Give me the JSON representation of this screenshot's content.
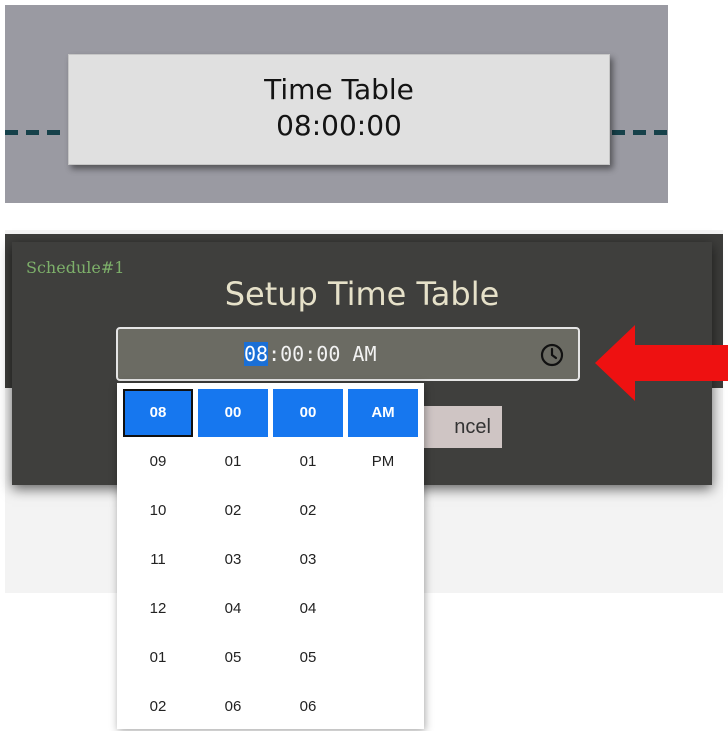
{
  "time_table_node": {
    "title": "Time Table",
    "time": "08:00:00"
  },
  "dialog": {
    "schedule_label": "Schedule#1",
    "title": "Setup Time Table",
    "time_input": {
      "hour": "08",
      "minute": "00",
      "second": "00",
      "ampm": "AM",
      "sep": ":"
    },
    "cancel_label": "ncel"
  },
  "icons": {
    "clock": "clock-icon",
    "arrow": "red-arrow-left-icon"
  },
  "picker": {
    "hours": [
      "08",
      "09",
      "10",
      "11",
      "12",
      "01",
      "02"
    ],
    "minutes": [
      "00",
      "01",
      "02",
      "03",
      "04",
      "05",
      "06"
    ],
    "seconds": [
      "00",
      "01",
      "02",
      "03",
      "04",
      "05",
      "06"
    ],
    "periods": [
      "AM",
      "PM"
    ]
  },
  "colors": {
    "selected": "#1677ef",
    "highlight": "#1a6fd6",
    "arrow": "#ee1111",
    "schedule_label": "#7db06a",
    "title": "#e6e1c9"
  }
}
